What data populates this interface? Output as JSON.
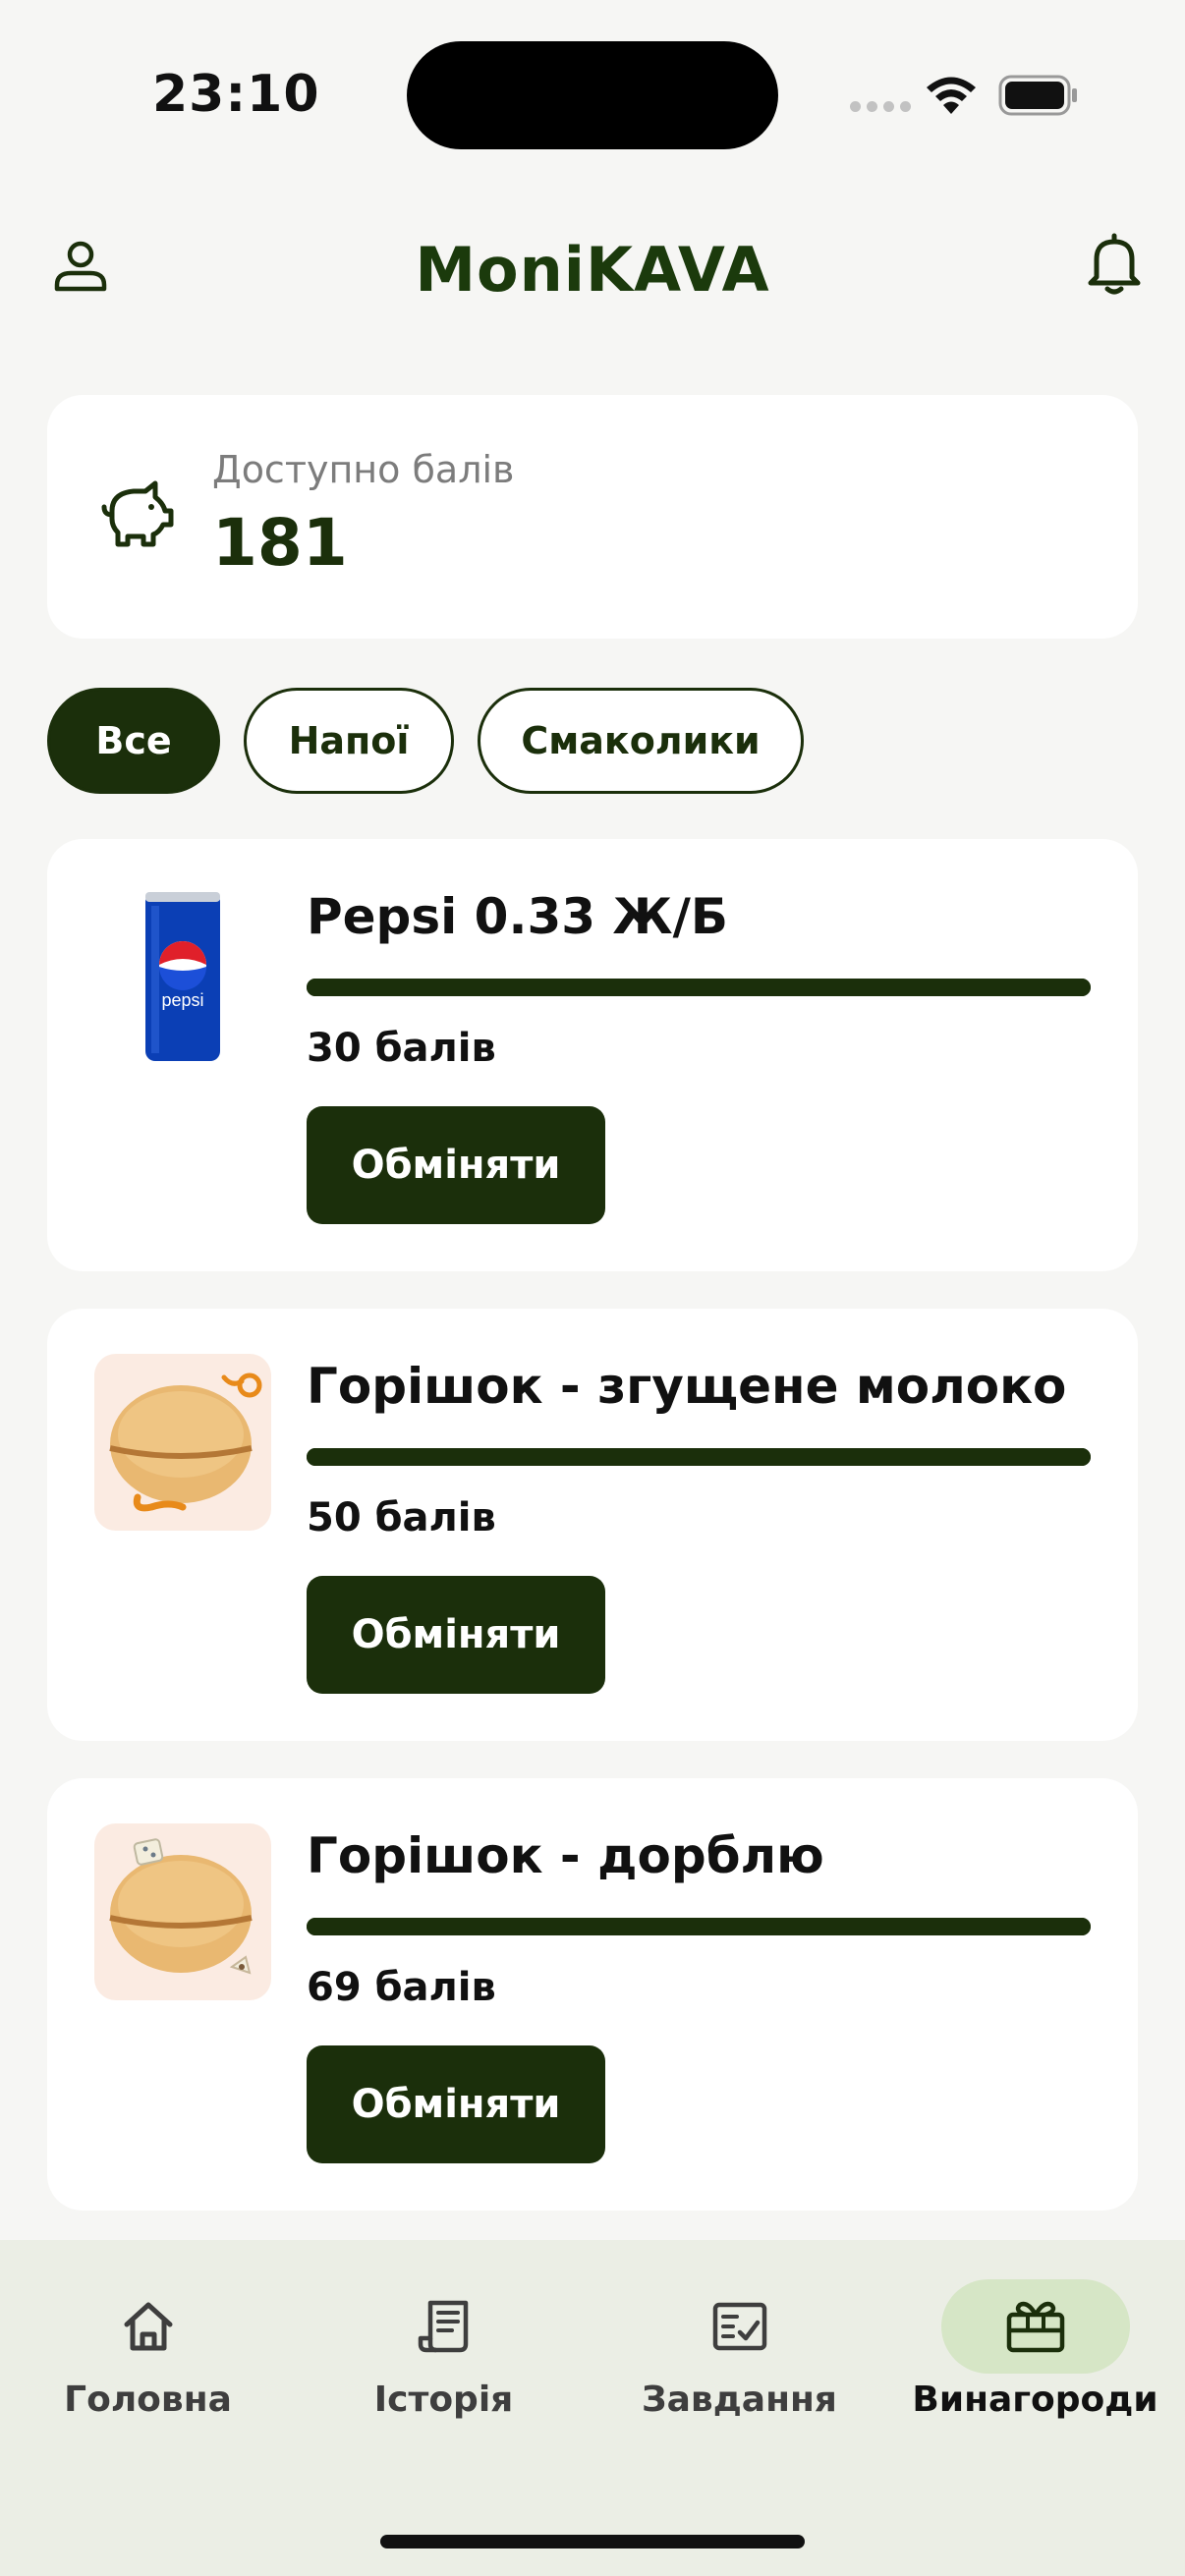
{
  "status_bar": {
    "time": "23:10"
  },
  "header": {
    "title": "MoniKAVA",
    "profile_icon": "person-icon",
    "bell_icon": "bell-icon"
  },
  "points": {
    "label": "Доступно балів",
    "value": "181",
    "icon": "piggy-bank-icon"
  },
  "filters": {
    "items": [
      {
        "label": "Все",
        "active": true
      },
      {
        "label": "Напої",
        "active": false
      },
      {
        "label": "Смаколики",
        "active": false
      }
    ]
  },
  "rewards": {
    "items": [
      {
        "name": "Pepsi 0.33 Ж/Б",
        "cost": "30 балів",
        "progress": 1.0,
        "button": "Обміняти"
      },
      {
        "name": "Горішок - згущене молоко",
        "cost": "50 балів",
        "progress": 1.0,
        "button": "Обміняти"
      },
      {
        "name": "Горішок - дорблю",
        "cost": "69 балів",
        "progress": 1.0,
        "button": "Обміняти"
      }
    ]
  },
  "bottom_nav": {
    "items": [
      {
        "label": "Головна",
        "icon": "home-icon",
        "active": false
      },
      {
        "label": "Історія",
        "icon": "receipt-icon",
        "active": false
      },
      {
        "label": "Завдання",
        "icon": "tasks-icon",
        "active": false
      },
      {
        "label": "Винагороди",
        "icon": "gift-icon",
        "active": true
      }
    ]
  },
  "colors": {
    "primary": "#1b2f0b",
    "background": "#f6f6f4",
    "nav_background": "#ebeee5",
    "nav_active_pill": "#d6e6c6"
  }
}
